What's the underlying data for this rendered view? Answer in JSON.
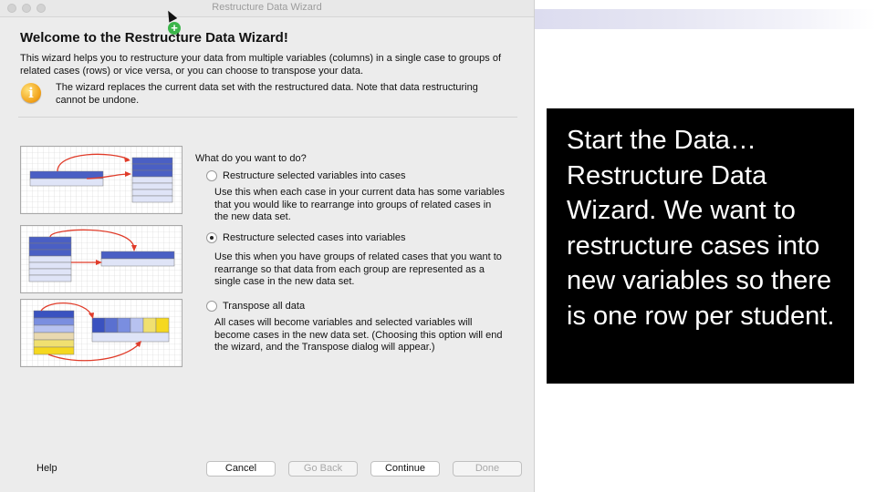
{
  "window": {
    "title": "Restructure Data Wizard"
  },
  "header": {
    "title": "Welcome to the Restructure Data Wizard!",
    "intro": "This wizard helps you to restructure your data from multiple variables (columns) in a single case to groups of related cases (rows) or vice versa, or you can choose to transpose your data.",
    "warning": "The wizard replaces the current data set with the restructured data.  Note that data restructuring cannot be undone."
  },
  "question": "What do you want to do?",
  "options": [
    {
      "label": "Restructure selected variables into cases",
      "selected": false,
      "description": "Use this when each case in your current data has some variables that you would like to rearrange into groups of related cases in the new data set."
    },
    {
      "label": "Restructure selected cases into variables",
      "selected": true,
      "description": "Use this when you have groups of related cases that you want to rearrange so that data from each group are represented as a single case in the new data set."
    },
    {
      "label": "Transpose all data",
      "selected": false,
      "description": "All cases will become variables and selected variables will become cases in the new data set. (Choosing this option will end the wizard, and the Transpose dialog will appear.)"
    }
  ],
  "footer": {
    "help": "Help",
    "cancel": "Cancel",
    "go_back": "Go Back",
    "continue": "Continue",
    "done": "Done"
  },
  "slide_note": "Start the Data…Restructure Data Wizard.  We want to restructure cases into new variables so there is one row per student.",
  "icons": {
    "info": "info-icon",
    "cursor": "arrow-cursor-icon",
    "plus": "plus-badge-icon"
  },
  "colors": {
    "window_bg": "#ececec",
    "note_bg": "#000000",
    "note_text": "#ffffff",
    "arrow": "#e03c2a",
    "radio_selected": "#222222"
  }
}
